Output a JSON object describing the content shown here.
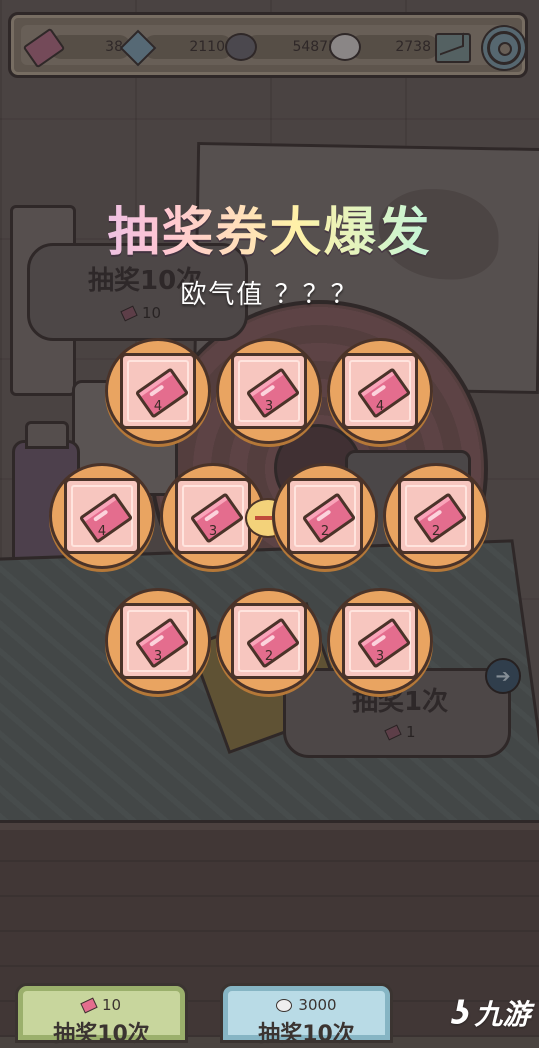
{
  "currencies": {
    "tickets": "38",
    "gems": "2110",
    "dark_bubbles": "54875",
    "white_bubbles": "2738"
  },
  "background_ui": {
    "left_panel": {
      "title": "抽奖10次",
      "cost": "10"
    },
    "right_panel": {
      "title": "抽奖1次",
      "cost": "1"
    }
  },
  "overlay": {
    "headline": "抽奖券大爆发",
    "luck_text": "欧气值 ？？？",
    "cards": [
      {
        "count": "4"
      },
      {
        "count": "3"
      },
      {
        "count": "4"
      },
      {
        "count": "4"
      },
      {
        "count": "3"
      },
      {
        "count": "2"
      },
      {
        "count": "2"
      },
      {
        "count": "3"
      },
      {
        "count": "2"
      },
      {
        "count": "3"
      }
    ]
  },
  "bottom_buttons": {
    "green": {
      "cost": "10",
      "label": "抽奖10次"
    },
    "blue": {
      "cost": "3000",
      "label": "抽奖10次"
    }
  },
  "watermark": {
    "mark": "ʖ",
    "text": "九游"
  },
  "colors": {
    "card_ring": "#e9a461",
    "card_face": "#f7c6bf",
    "ticket": "#e46d8e",
    "green_button": "#c8d69d",
    "blue_button": "#b9dbe6"
  }
}
